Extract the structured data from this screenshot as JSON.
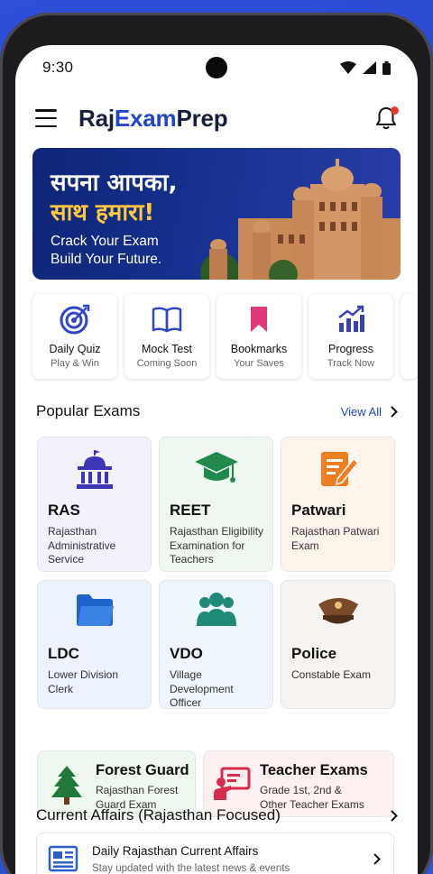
{
  "status": {
    "time": "9:30"
  },
  "app": {
    "title_part1": "Raj",
    "title_part2": "Exam",
    "title_part3": "Prep"
  },
  "banner": {
    "headline1": "सपना आपका,",
    "headline2": "साथ हमारा!",
    "sub1": "Crack Your Exam",
    "sub2": "Build Your Future."
  },
  "quick_actions": [
    {
      "label": "Daily Quiz",
      "sub": "Play & Win",
      "icon": "target-icon"
    },
    {
      "label": "Mock Test",
      "sub": "Coming Soon",
      "icon": "book-icon"
    },
    {
      "label": "Bookmarks",
      "sub": "Your Saves",
      "icon": "bookmark-icon"
    },
    {
      "label": "Progress",
      "sub": "Track Now",
      "icon": "chart-icon"
    }
  ],
  "popular": {
    "title": "Popular Exams",
    "view_all": "View All",
    "exams": [
      {
        "name": "RAS",
        "desc": "Rajasthan Administrative Service",
        "icon": "building-icon",
        "bg": "#f3f1fc"
      },
      {
        "name": "REET",
        "desc": "Rajasthan Eligibility Examination for Teachers",
        "icon": "graduation-cap-icon",
        "bg": "#eef8f1"
      },
      {
        "name": "Patwari",
        "desc": "Rajasthan Patwari Exam",
        "icon": "document-edit-icon",
        "bg": "#fdf5ec"
      },
      {
        "name": "LDC",
        "desc": "Lower Division Clerk",
        "icon": "folder-icon",
        "bg": "#ecf3fc"
      },
      {
        "name": "VDO",
        "desc": "Village Development Officer",
        "icon": "group-icon",
        "bg": "#ecf6fb"
      },
      {
        "name": "Police",
        "desc": "Constable Exam",
        "icon": "police-cap-icon",
        "bg": "#f6f3f0"
      }
    ],
    "wide": [
      {
        "name": "Forest Guard",
        "desc1": "Rajasthan Forest",
        "desc2": "Guard Exam",
        "icon": "tree-icon",
        "bg": "#eef8ef"
      },
      {
        "name": "Teacher Exams",
        "desc1": "Grade 1st, 2nd &",
        "desc2": "Other Teacher Exams",
        "icon": "teacher-board-icon",
        "bg": "#fdf0f1"
      }
    ]
  },
  "current_affairs": {
    "title": "Current Affairs (Rajasthan Focused)",
    "item_title": "Daily Rajasthan Current Affairs",
    "item_sub": "Stay updated with the latest news & events"
  },
  "colors": {
    "brand": "#2345c8",
    "banner_bg": "#14308c",
    "highlight": "#ffc83d"
  }
}
